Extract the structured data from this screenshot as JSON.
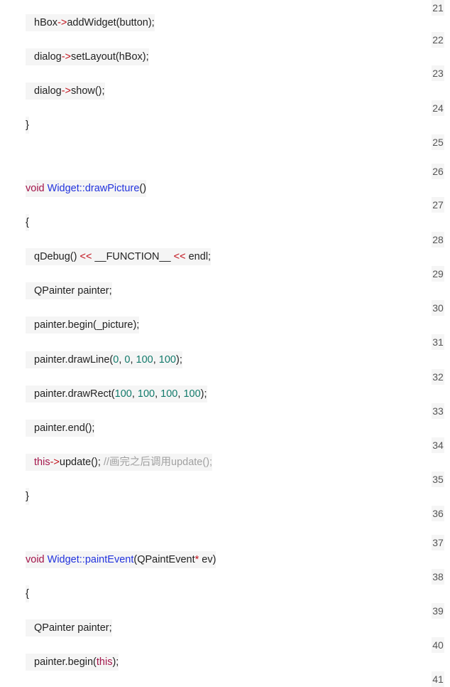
{
  "code_lines": [
    {
      "tokens": [
        {
          "t": "hBox",
          "c": "plain"
        },
        {
          "t": "->",
          "c": "op"
        },
        {
          "t": "addWidget(button);",
          "c": "plain"
        }
      ]
    },
    {
      "tokens": [
        {
          "t": "dialog",
          "c": "plain"
        },
        {
          "t": "->",
          "c": "op"
        },
        {
          "t": "setLayout(hBox);",
          "c": "plain"
        }
      ]
    },
    {
      "tokens": [
        {
          "t": "dialog",
          "c": "plain"
        },
        {
          "t": "->",
          "c": "op"
        },
        {
          "t": "show();",
          "c": "plain"
        }
      ]
    },
    {
      "tokens": [
        {
          "t": "}",
          "c": "plain"
        }
      ]
    },
    {
      "tokens": [
        {
          "t": "void",
          "c": "kw"
        },
        {
          "t": " ",
          "c": "plain"
        },
        {
          "t": "Widget::drawPicture",
          "c": "fn"
        },
        {
          "t": "()",
          "c": "plain"
        }
      ]
    },
    {
      "tokens": [
        {
          "t": "{",
          "c": "plain"
        }
      ]
    },
    {
      "tokens": [
        {
          "t": "qDebug() ",
          "c": "plain"
        },
        {
          "t": "<<",
          "c": "op"
        },
        {
          "t": " __FUNCTION__ ",
          "c": "plain"
        },
        {
          "t": "<<",
          "c": "op"
        },
        {
          "t": " endl;",
          "c": "plain"
        }
      ]
    },
    {
      "tokens": [
        {
          "t": "QPainter painter;",
          "c": "plain"
        }
      ]
    },
    {
      "tokens": [
        {
          "t": "painter.begin(_picture);",
          "c": "plain"
        }
      ]
    },
    {
      "tokens": [
        {
          "t": "painter.drawLine(",
          "c": "plain"
        },
        {
          "t": "0",
          "c": "num"
        },
        {
          "t": ", ",
          "c": "plain"
        },
        {
          "t": "0",
          "c": "num"
        },
        {
          "t": ", ",
          "c": "plain"
        },
        {
          "t": "100",
          "c": "num"
        },
        {
          "t": ", ",
          "c": "plain"
        },
        {
          "t": "100",
          "c": "num"
        },
        {
          "t": ");",
          "c": "plain"
        }
      ]
    },
    {
      "tokens": [
        {
          "t": "painter.drawRect(",
          "c": "plain"
        },
        {
          "t": "100",
          "c": "num"
        },
        {
          "t": ", ",
          "c": "plain"
        },
        {
          "t": "100",
          "c": "num"
        },
        {
          "t": ", ",
          "c": "plain"
        },
        {
          "t": "100",
          "c": "num"
        },
        {
          "t": ", ",
          "c": "plain"
        },
        {
          "t": "100",
          "c": "num"
        },
        {
          "t": ");",
          "c": "plain"
        }
      ]
    },
    {
      "tokens": [
        {
          "t": "painter.end();",
          "c": "plain"
        }
      ]
    },
    {
      "tokens": [
        {
          "t": "this",
          "c": "thiskw"
        },
        {
          "t": "->",
          "c": "op"
        },
        {
          "t": "update(); ",
          "c": "plain"
        },
        {
          "t": "//画完之后调用update();",
          "c": "comment"
        }
      ]
    },
    {
      "tokens": [
        {
          "t": "}",
          "c": "plain"
        }
      ]
    },
    {
      "tokens": [
        {
          "t": "void",
          "c": "kw"
        },
        {
          "t": " ",
          "c": "plain"
        },
        {
          "t": "Widget::paintEvent",
          "c": "fn"
        },
        {
          "t": "(QPaintEvent",
          "c": "plain"
        },
        {
          "t": "*",
          "c": "op"
        },
        {
          "t": " ev)",
          "c": "plain"
        }
      ]
    },
    {
      "tokens": [
        {
          "t": "{",
          "c": "plain"
        }
      ]
    },
    {
      "tokens": [
        {
          "t": "QPainter painter;",
          "c": "plain"
        }
      ]
    },
    {
      "tokens": [
        {
          "t": "painter.begin(",
          "c": "plain"
        },
        {
          "t": "this",
          "c": "thiskw"
        },
        {
          "t": ");",
          "c": "plain"
        }
      ]
    }
  ],
  "line_numbers": [
    "21",
    "22",
    "23",
    "24",
    "25",
    "26",
    "27",
    "28",
    "29",
    "30",
    "31",
    "32",
    "33",
    "34",
    "35",
    "36",
    "37",
    "38",
    "39",
    "40",
    "41"
  ],
  "colors": {
    "keyword": "#a3154a",
    "function": "#2233dd",
    "operator": "#c1121c",
    "number": "#127a6b",
    "comment": "#a0a0a0",
    "line_bg": "#f5f5f5"
  }
}
